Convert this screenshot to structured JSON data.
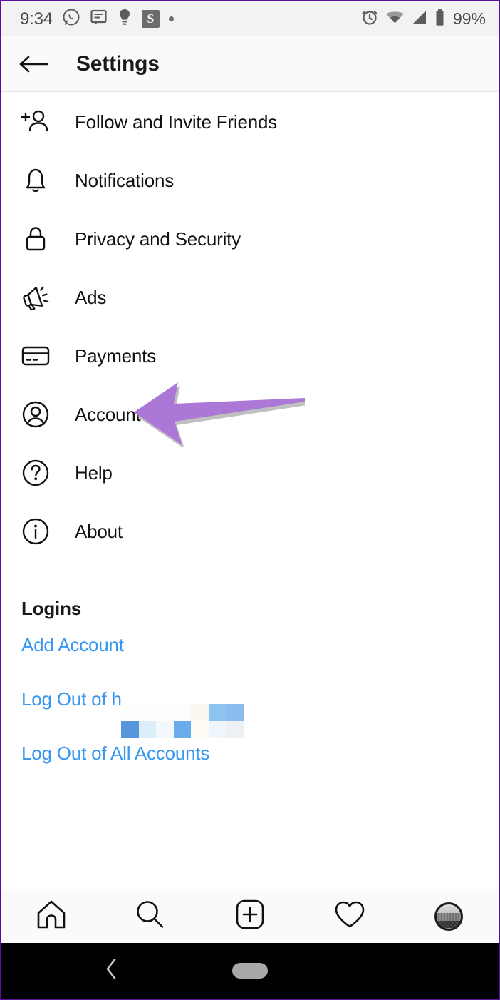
{
  "statusbar": {
    "time": "9:34",
    "battery": "99%",
    "left_icons": [
      {
        "name": "whatsapp-icon"
      },
      {
        "name": "messages-icon"
      },
      {
        "name": "lightbulb-icon"
      },
      {
        "name": "skype-icon",
        "glyph": "S"
      },
      {
        "name": "more-notifications-dot-icon"
      }
    ],
    "right_icons": [
      {
        "name": "alarm-icon"
      },
      {
        "name": "wifi-icon"
      },
      {
        "name": "cellular-signal-icon"
      },
      {
        "name": "battery-icon"
      }
    ]
  },
  "appbar": {
    "back_label": "back-arrow",
    "title": "Settings"
  },
  "settings": {
    "items": [
      {
        "icon": "follow-invite-friends-icon",
        "label": "Follow and Invite Friends"
      },
      {
        "icon": "bell-icon",
        "label": "Notifications"
      },
      {
        "icon": "lock-icon",
        "label": "Privacy and Security"
      },
      {
        "icon": "megaphone-icon",
        "label": "Ads"
      },
      {
        "icon": "credit-card-icon",
        "label": "Payments"
      },
      {
        "icon": "account-circle-icon",
        "label": "Account"
      },
      {
        "icon": "help-circle-icon",
        "label": "Help"
      },
      {
        "icon": "info-circle-icon",
        "label": "About"
      }
    ]
  },
  "logins": {
    "title": "Logins",
    "add_account": "Add Account",
    "logout_user": "Log Out of h",
    "logout_all": "Log Out of All Accounts",
    "link_color": "#3897f0",
    "censor_colors": [
      "#fdfdfb",
      "#fdfdfd",
      "#fdfdfd",
      "#fdfdfd",
      "#fbf7ee",
      "#8dc4f0",
      "#fcfcfa",
      "#5596dd",
      "#ddeefb",
      "#f2f8fb",
      "#6aabec",
      "#fdfbf4",
      "#eef6fc",
      "#edf1f3"
    ],
    "censor_colors_row2_extra": "#8dbdef"
  },
  "annotation": {
    "arrow_name": "purple-annotation-arrow",
    "arrow_color": "#ab78d8",
    "arrow_shadow": "#8a8a8a",
    "points_at": "Account"
  },
  "tabbar": {
    "items": [
      {
        "icon": "home-icon",
        "name": "tab-home"
      },
      {
        "icon": "search-icon",
        "name": "tab-search"
      },
      {
        "icon": "add-post-icon",
        "name": "tab-add-post"
      },
      {
        "icon": "heart-activity-icon",
        "name": "tab-activity"
      },
      {
        "icon": "profile-avatar-icon",
        "name": "tab-profile"
      }
    ]
  },
  "navbar": {
    "back": "android-back-icon",
    "home": "android-home-pill"
  },
  "colors": {
    "frame_border": "#5b0f9e",
    "statusbar_bg": "#f2f2f2",
    "appbar_bg": "#fafafa",
    "text": "#111111"
  }
}
